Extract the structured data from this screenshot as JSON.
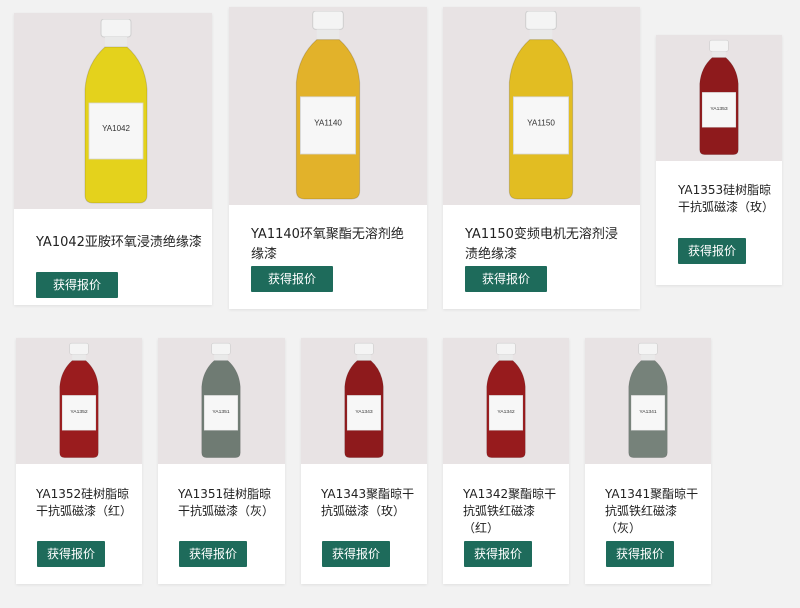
{
  "products": [
    {
      "title": "YA1042亚胺环氧浸渍绝缘漆",
      "label_code": "YA1042",
      "button": "获得报价",
      "color": "#e4d21c"
    },
    {
      "title": "YA1140环氧聚酯无溶剂绝缘漆",
      "label_code": "YA1140",
      "button": "获得报价",
      "color": "#e2b22a"
    },
    {
      "title": "YA1150变频电机无溶剂浸渍绝缘漆",
      "label_code": "YA1150",
      "button": "获得报价",
      "color": "#e2bd22"
    },
    {
      "title": "YA1353硅树脂晾干抗弧磁漆（玫）",
      "label_code": "YA1353",
      "button": "获得报价",
      "color": "#8e1a1c"
    },
    {
      "title": "YA1352硅树脂晾干抗弧磁漆（红）",
      "label_code": "YA1352",
      "button": "获得报价",
      "color": "#9a1c1e"
    },
    {
      "title": "YA1351硅树脂晾干抗弧磁漆（灰）",
      "label_code": "YA1351",
      "button": "获得报价",
      "color": "#6f7b73"
    },
    {
      "title": "YA1343聚酯晾干抗弧磁漆（玫）",
      "label_code": "YA1343",
      "button": "获得报价",
      "color": "#8e1a1c"
    },
    {
      "title": "YA1342聚酯晾干抗弧铁红磁漆（红）",
      "label_code": "YA1342",
      "button": "获得报价",
      "color": "#971b1d"
    },
    {
      "title": "YA1341聚酯晾干抗弧铁红磁漆（灰）",
      "label_code": "YA1341",
      "button": "获得报价",
      "color": "#76827a"
    }
  ]
}
